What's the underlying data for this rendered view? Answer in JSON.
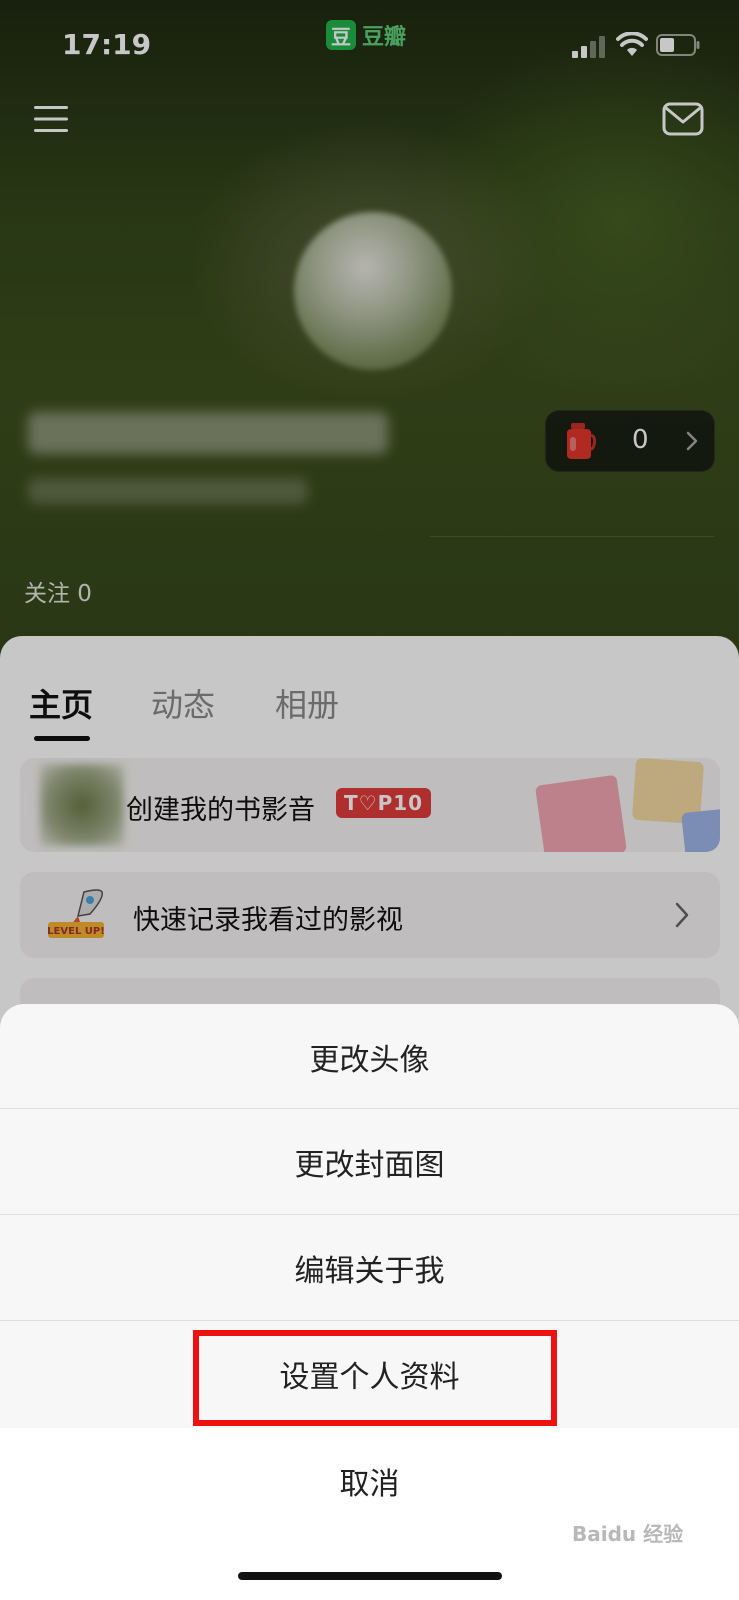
{
  "status_bar": {
    "time": "17:19",
    "app_logo_char": "豆",
    "app_name": "豆瓣"
  },
  "header": {
    "menu_icon": "hamburger-icon",
    "mail_icon": "mail-icon"
  },
  "profile": {
    "coins_value": "0",
    "follow_label": "关注 0"
  },
  "tabs": [
    {
      "label": "主页",
      "active": true
    },
    {
      "label": "动态",
      "active": false
    },
    {
      "label": "相册",
      "active": false
    }
  ],
  "cards": {
    "top10_text": "创建我的书影音",
    "top10_badge": "T♡P10",
    "record_text": "快速记录我看过的影视"
  },
  "action_sheet": {
    "items": [
      "更改头像",
      "更改封面图",
      "编辑关于我",
      "设置个人资料"
    ],
    "cancel": "取消",
    "highlight_color": "#ee1111"
  },
  "watermark": "Baidu 经验"
}
